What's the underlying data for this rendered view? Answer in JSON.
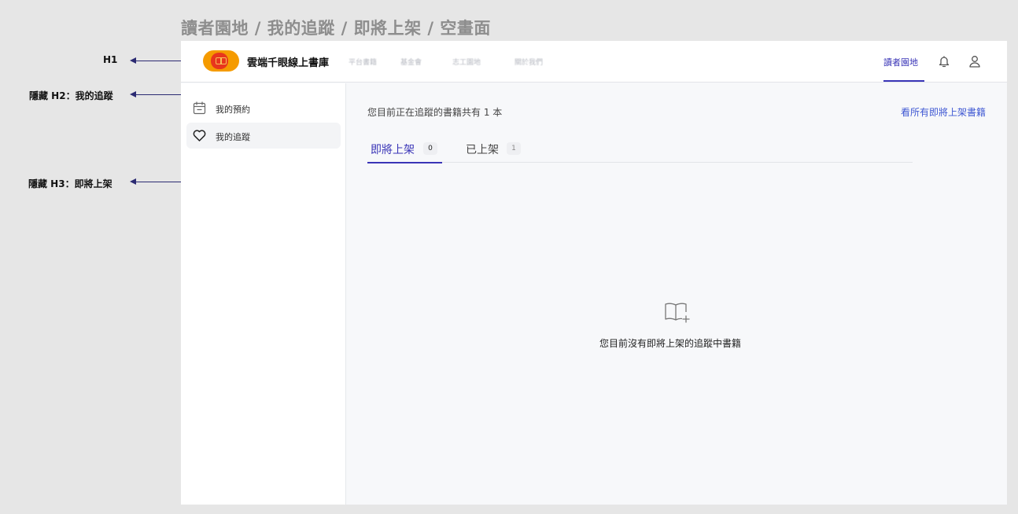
{
  "page_heading": "讀者園地 / 我的追蹤 / 即將上架 / 空畫面",
  "annotations": [
    {
      "label": "H1"
    },
    {
      "label": "隱藏 H2：我的追蹤"
    },
    {
      "label": "隱藏 H3：即將上架"
    }
  ],
  "header": {
    "site_name": "雲端千眼線上書庫",
    "nav_links": [
      "平台書籍",
      "基金會",
      "志工園地",
      "關於我們"
    ],
    "active_link": "讀者園地",
    "icons": [
      "bell-icon",
      "user-icon"
    ]
  },
  "sidebar": {
    "items": [
      {
        "label": "我的預約",
        "icon": "calendar-icon",
        "active": false
      },
      {
        "label": "我的追蹤",
        "icon": "heart-icon",
        "active": true
      }
    ]
  },
  "main": {
    "count_text": "您目前正在追蹤的書籍共有 1 本",
    "see_all_link": "看所有即將上架書籍",
    "tabs": [
      {
        "label": "即將上架",
        "count": "0",
        "active": true
      },
      {
        "label": "已上架",
        "count": "1",
        "active": false
      }
    ],
    "empty_state": {
      "icon": "book-add-icon",
      "text": "您目前沒有即將上架的追蹤中書籍"
    }
  },
  "colors": {
    "accent": "#3a35b7",
    "link": "#3f58d3",
    "annotation": "#2b2a72",
    "logo_orange": "#f59b00",
    "logo_red": "#e8361d"
  }
}
